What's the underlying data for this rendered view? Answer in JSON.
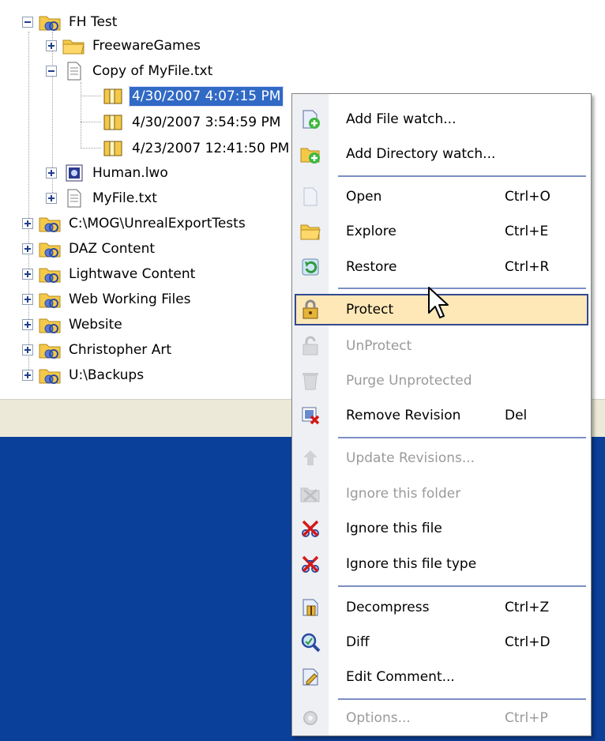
{
  "tree": {
    "items": [
      {
        "label": "FH Test",
        "icon": "watched-folder-icon",
        "toggle": "minus"
      },
      {
        "label": "FreewareGames",
        "icon": "folder-icon",
        "toggle": "plus"
      },
      {
        "label": "Copy of MyFile.txt",
        "icon": "text-file-icon",
        "toggle": "minus"
      },
      {
        "label": "4/30/2007 4:07:15 PM",
        "icon": "revision-icon",
        "toggle": ""
      },
      {
        "label": "4/30/2007 3:54:59 PM",
        "icon": "revision-icon",
        "toggle": ""
      },
      {
        "label": "4/23/2007 12:41:50 PM",
        "icon": "revision-icon",
        "toggle": ""
      },
      {
        "label": "Human.lwo",
        "icon": "object-file-icon",
        "toggle": "plus"
      },
      {
        "label": "MyFile.txt",
        "icon": "text-file-icon",
        "toggle": "plus"
      },
      {
        "label": "C:\\MOG\\UnrealExportTests",
        "icon": "watched-folder-icon",
        "toggle": "plus"
      },
      {
        "label": "DAZ Content",
        "icon": "watched-folder-icon",
        "toggle": "plus"
      },
      {
        "label": "Lightwave Content",
        "icon": "watched-folder-icon",
        "toggle": "plus"
      },
      {
        "label": "Web Working Files",
        "icon": "watched-folder-icon",
        "toggle": "plus"
      },
      {
        "label": "Website",
        "icon": "watched-folder-icon",
        "toggle": "plus"
      },
      {
        "label": "Christopher Art",
        "icon": "watched-folder-icon",
        "toggle": "plus"
      },
      {
        "label": "U:\\Backups",
        "icon": "watched-folder-icon",
        "toggle": "plus"
      }
    ]
  },
  "menu": {
    "items": [
      {
        "label": "Add File watch...",
        "shortcut": "",
        "icon": "add-file-watch-icon",
        "enabled": true
      },
      {
        "label": "Add Directory watch...",
        "shortcut": "",
        "icon": "add-directory-watch-icon",
        "enabled": true
      },
      {
        "label": "Open",
        "shortcut": "Ctrl+O",
        "icon": "open-file-icon",
        "enabled": true
      },
      {
        "label": "Explore",
        "shortcut": "Ctrl+E",
        "icon": "explore-folder-icon",
        "enabled": true
      },
      {
        "label": "Restore",
        "shortcut": "Ctrl+R",
        "icon": "restore-icon",
        "enabled": true
      },
      {
        "label": "Protect",
        "shortcut": "",
        "icon": "protect-icon",
        "enabled": true,
        "highlighted": true
      },
      {
        "label": "UnProtect",
        "shortcut": "",
        "icon": "unprotect-icon",
        "enabled": false
      },
      {
        "label": "Purge Unprotected",
        "shortcut": "",
        "icon": "purge-icon",
        "enabled": false
      },
      {
        "label": "Remove Revision",
        "shortcut": "Del",
        "icon": "remove-revision-icon",
        "enabled": true
      },
      {
        "label": "Update Revisions...",
        "shortcut": "",
        "icon": "update-revisions-icon",
        "enabled": false
      },
      {
        "label": "Ignore this folder",
        "shortcut": "",
        "icon": "ignore-folder-icon",
        "enabled": false
      },
      {
        "label": "Ignore this file",
        "shortcut": "",
        "icon": "ignore-file-icon",
        "enabled": true
      },
      {
        "label": "Ignore this file type",
        "shortcut": "",
        "icon": "ignore-file-type-icon",
        "enabled": true
      },
      {
        "label": "Decompress",
        "shortcut": "Ctrl+Z",
        "icon": "decompress-icon",
        "enabled": true
      },
      {
        "label": "Diff",
        "shortcut": "Ctrl+D",
        "icon": "diff-icon",
        "enabled": true
      },
      {
        "label": "Edit Comment...",
        "shortcut": "",
        "icon": "edit-comment-icon",
        "enabled": true
      },
      {
        "label": "Options...",
        "shortcut": "Ctrl+P",
        "icon": "options-icon",
        "enabled": false
      }
    ]
  },
  "colors": {
    "selection": "#316ac5",
    "highlight": "#ffe8b8",
    "desktop_blue": "#0a3f9a",
    "folder_yellow": "#f4c94a"
  }
}
